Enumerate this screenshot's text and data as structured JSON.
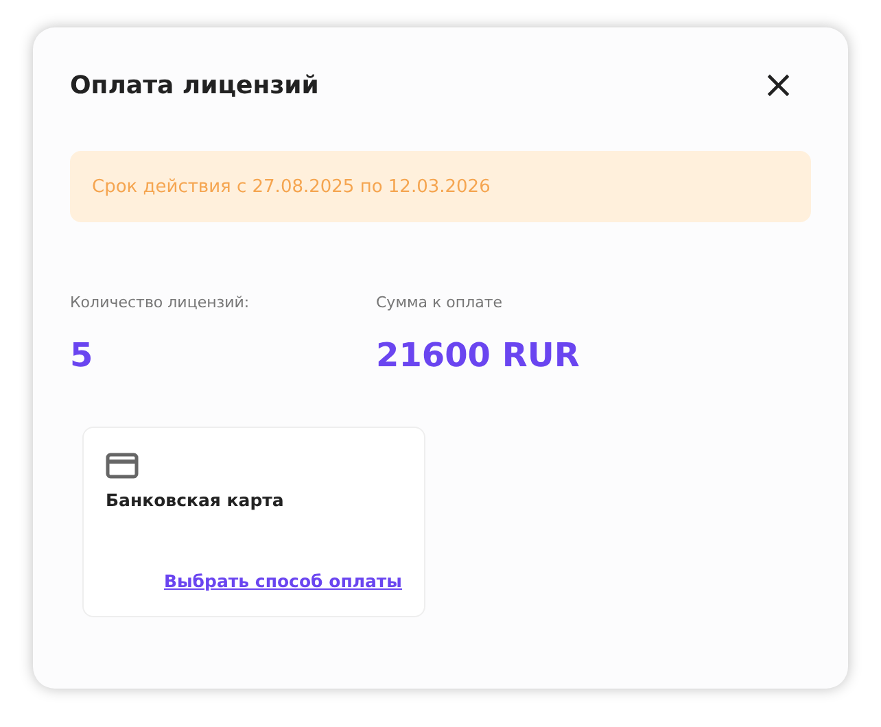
{
  "dialog": {
    "title": "Оплата лицензий",
    "close_label": "×"
  },
  "notice": {
    "text": "Срок действия с 27.08.2025 по 12.03.2026"
  },
  "summary": [
    {
      "label": "Количество лицензий:",
      "value": "5"
    },
    {
      "label": "Сумма к оплате",
      "value": "21600 RUR"
    }
  ],
  "payment_methods": [
    {
      "title": "Банковская карта",
      "link": "Выбрать способ оплаты"
    }
  ]
}
